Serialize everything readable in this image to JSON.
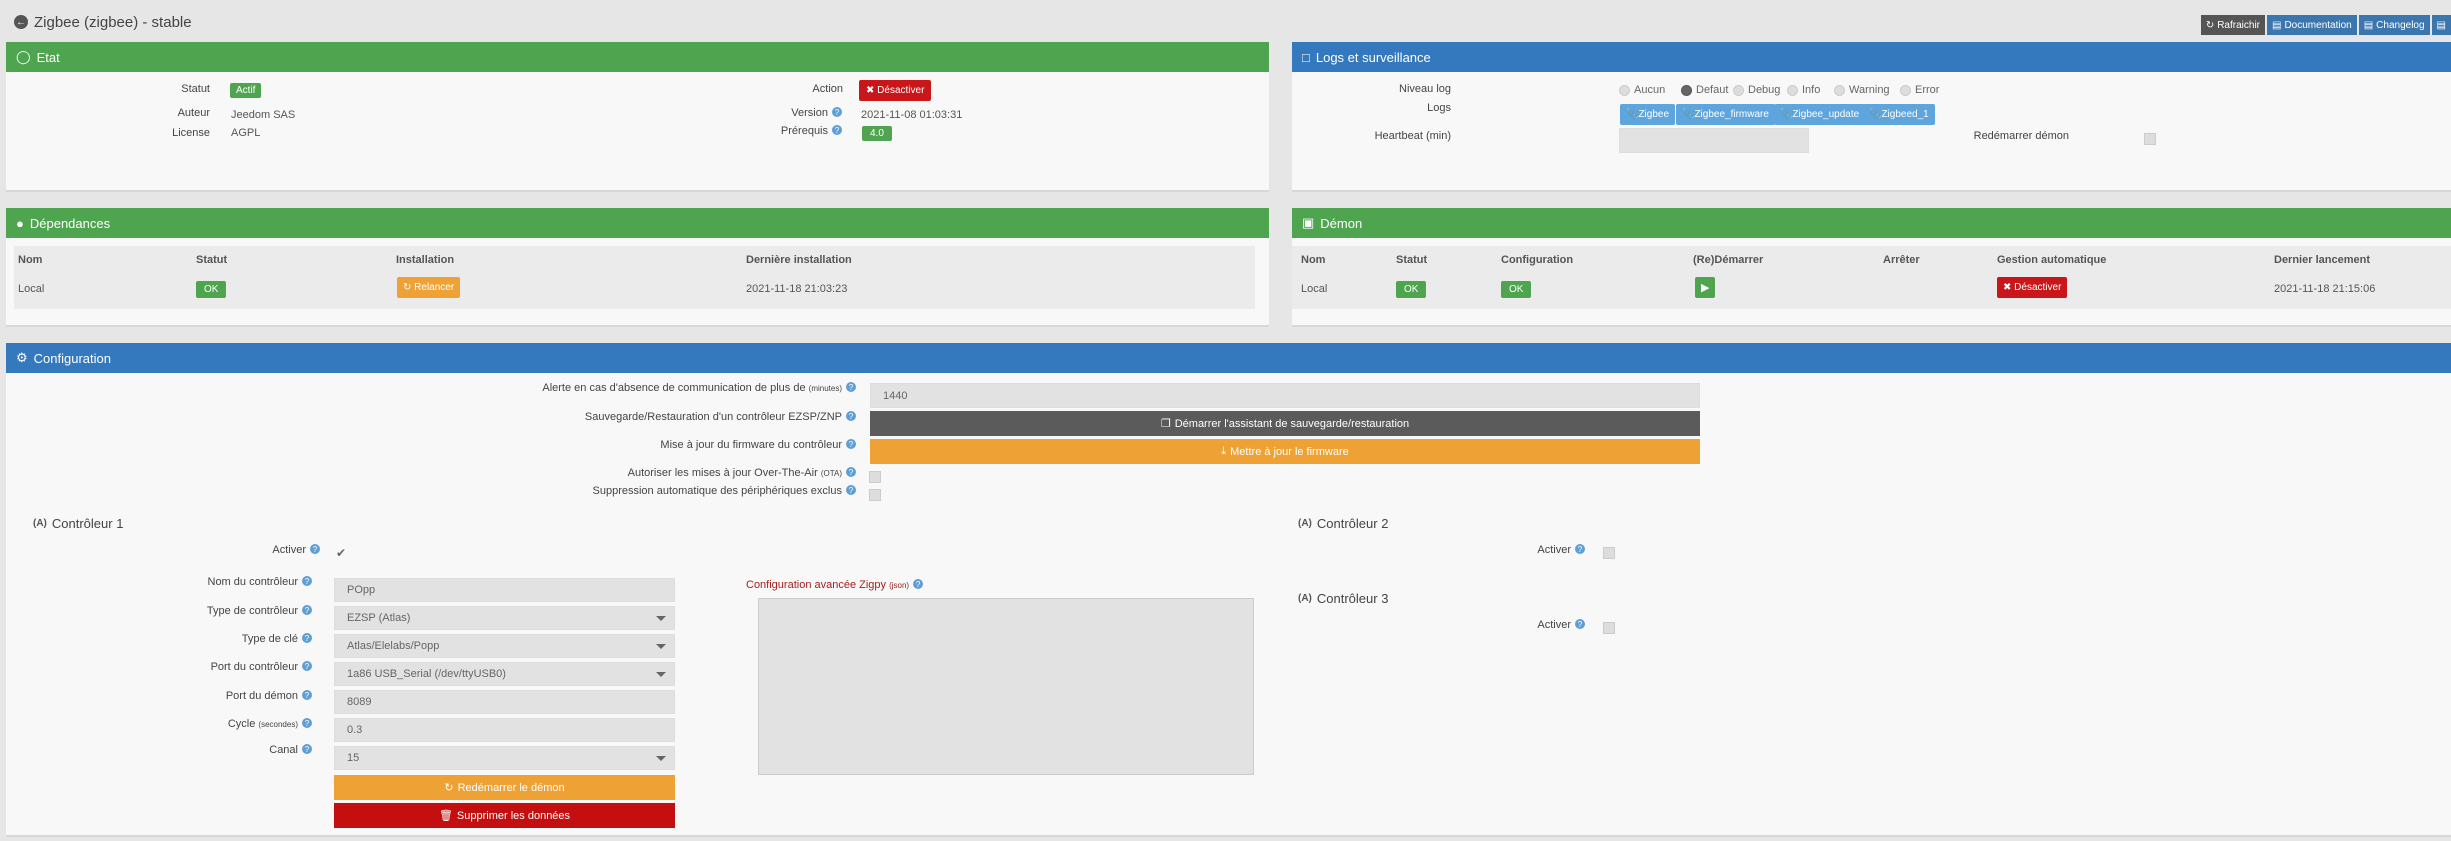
{
  "page": {
    "title": "Zigbee (zigbee) - stable"
  },
  "toolbar": {
    "refresh": "Rafraichir",
    "documentation": "Documentation",
    "changelog": "Changelog"
  },
  "etat": {
    "title": "Etat",
    "statut_label": "Statut",
    "statut_value": "Actif",
    "auteur_label": "Auteur",
    "auteur_value": "Jeedom SAS",
    "license_label": "License",
    "license_value": "AGPL",
    "action_label": "Action",
    "action_button": "Désactiver",
    "version_label": "Version",
    "version_value": "2021-11-08 01:03:31",
    "prerequis_label": "Prérequis",
    "prerequis_value": "4.0"
  },
  "logs": {
    "title": "Logs et surveillance",
    "niveau_label": "Niveau log",
    "levels": [
      "Aucun",
      "Defaut",
      "Debug",
      "Info",
      "Warning",
      "Error"
    ],
    "selected_level": "Defaut",
    "logs_label": "Logs",
    "log_buttons": [
      "Zigbee",
      "Zigbee_firmware",
      "Zigbee_update",
      "Zigbeed_1"
    ],
    "heartbeat_label": "Heartbeat (min)",
    "heartbeat_value": "",
    "restart_label": "Redémarrer démon"
  },
  "dependances": {
    "title": "Dépendances",
    "headers": [
      "Nom",
      "Statut",
      "Installation",
      "Dernière installation"
    ],
    "row": {
      "nom": "Local",
      "statut": "OK",
      "installation": "Relancer",
      "derniere": "2021-11-18 21:03:23"
    }
  },
  "demon": {
    "title": "Démon",
    "headers": [
      "Nom",
      "Statut",
      "Configuration",
      "(Re)Démarrer",
      "Arrêter",
      "Gestion automatique",
      "Dernier lancement"
    ],
    "row": {
      "nom": "Local",
      "statut": "OK",
      "configuration": "OK",
      "gestion": "Désactiver",
      "dernier": "2021-11-18 21:15:06"
    }
  },
  "config": {
    "title": "Configuration",
    "alerte_label": "Alerte en cas d'absence de communication de plus de",
    "alerte_unit": "(minutes)",
    "alerte_value": "1440",
    "sauvegarde_label": "Sauvegarde/Restauration d'un contrôleur EZSP/ZNP",
    "sauvegarde_button": "Démarrer l'assistant de sauvegarde/restauration",
    "firmware_label": "Mise à jour du firmware du contrôleur",
    "firmware_button": "Mettre à jour le firmware",
    "ota_label": "Autoriser les mises à jour Over-The-Air",
    "ota_unit": "(OTA)",
    "exclus_label": "Suppression automatique des périphériques exclus",
    "ctrl1": {
      "title": "Contrôleur 1",
      "activer_label": "Activer",
      "nom_label": "Nom du contrôleur",
      "nom_value": "POpp",
      "type_label": "Type de contrôleur",
      "type_value": "EZSP (Atlas)",
      "cle_label": "Type de clé",
      "cle_value": "Atlas/Elelabs/Popp",
      "port_label": "Port du contrôleur",
      "port_value": "1a86 USB_Serial (/dev/ttyUSB0)",
      "demon_port_label": "Port du démon",
      "demon_port_value": "8089",
      "cycle_label": "Cycle",
      "cycle_unit": "(secondes)",
      "cycle_value": "0.3",
      "canal_label": "Canal",
      "canal_value": "15",
      "restart_button": "Redémarrer le démon",
      "delete_button": "Supprimer les données",
      "advanced_label": "Configuration avancée Zigpy",
      "advanced_unit": "(json)"
    },
    "ctrl2": {
      "title": "Contrôleur 2",
      "activer_label": "Activer"
    },
    "ctrl3": {
      "title": "Contrôleur 3",
      "activer_label": "Activer"
    }
  }
}
